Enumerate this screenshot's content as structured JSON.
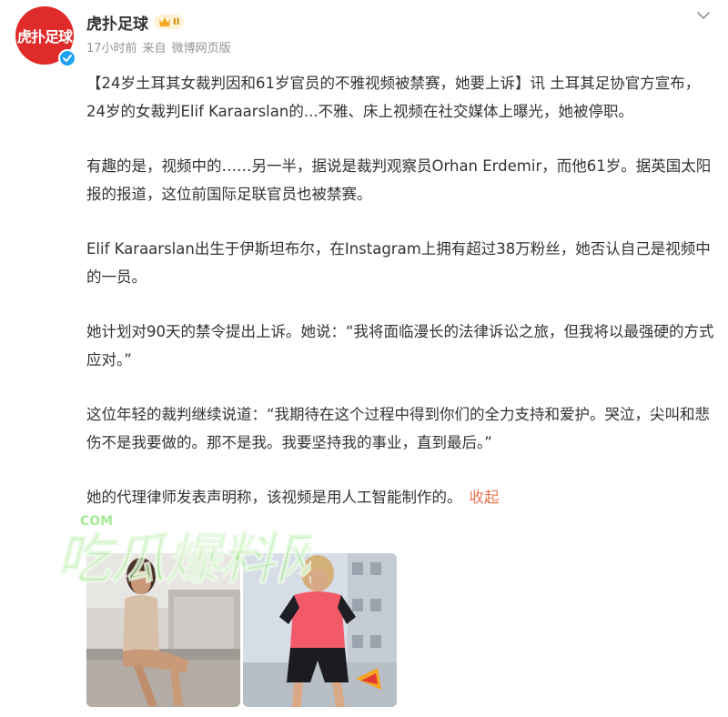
{
  "post": {
    "avatar_text": "虎扑足球",
    "author": "虎扑足球",
    "vip_level": "II",
    "time": "17小时前",
    "source_prefix": "来自",
    "source": "微博网页版",
    "paragraphs": [
      "【24岁土耳其女裁判因和61岁官员的不雅视频被禁赛，她要上诉】讯 土耳其足协官方宣布，24岁的女裁判Elif Karaarslan的...不雅、床上视频在社交媒体上曝光，她被停职。",
      "有趣的是，视频中的……另一半，据说是裁判观察员Orhan Erdemir，而他61岁。据英国太阳报的报道，这位前国际足联官员也被禁赛。",
      "Elif Karaarslan出生于伊斯坦布尔，在Instagram上拥有超过38万粉丝，她否认自己是视频中的一员。",
      "她计划对90天的禁令提出上诉。她说：“我将面临漫长的法律诉讼之旅，但我将以最强硬的方式应对。”",
      "这位年轻的裁判继续说道：“我期待在这个过程中得到你们的全力支持和爱护。哭泣，尖叫和悲伤不是我要做的。那不是我。我要坚持我的事业，直到最后。”",
      "她的代理律师发表声明称，该视频是用人工智能制作的。"
    ],
    "collapse_label": "收起"
  },
  "watermark": {
    "main": "吃瓜爆料网",
    "small": "COM"
  },
  "colors": {
    "accent": "#eb7350",
    "avatar_bg": "#e02b2b",
    "verified": "#1da1f2",
    "watermark": "#5cd83a"
  },
  "icons": {
    "verified": "verified-check-icon",
    "vip": "crown-icon",
    "menu": "chevron-down-icon"
  }
}
